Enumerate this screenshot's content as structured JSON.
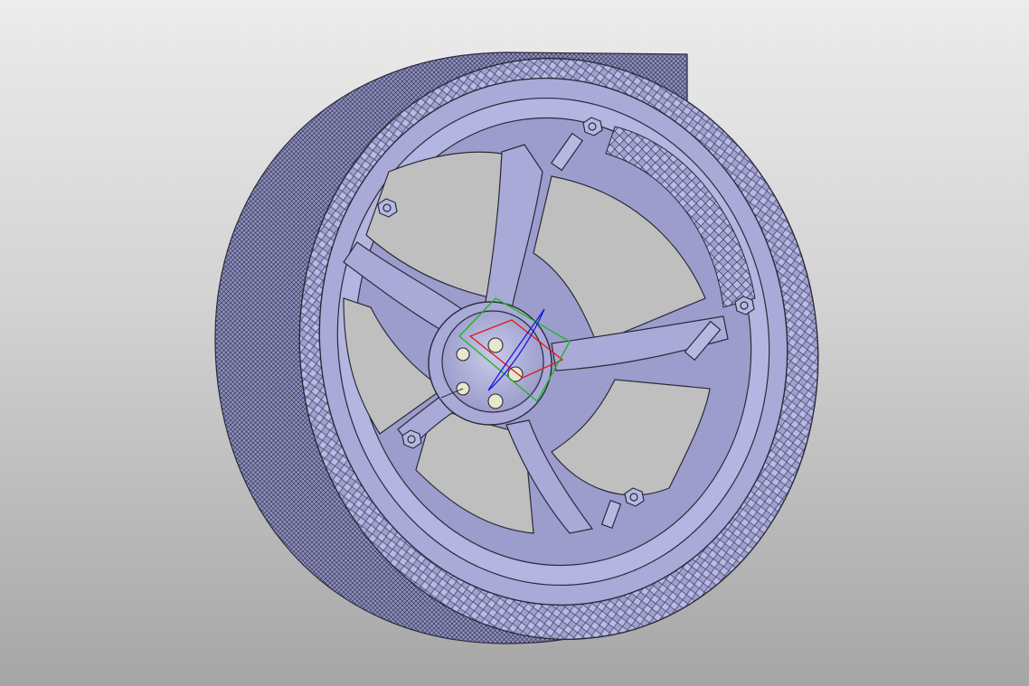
{
  "scene": {
    "model": "wheel-assembly",
    "background_top": "#ececec",
    "background_bottom": "#a6a6a6",
    "body_color": "#a9aad8",
    "edge_color": "#2a2a3a",
    "lug_nut_color": "#e7e6cf",
    "triad_x_color": "#e01818",
    "triad_y_color": "#18b818",
    "triad_z_color": "#1818e0"
  }
}
